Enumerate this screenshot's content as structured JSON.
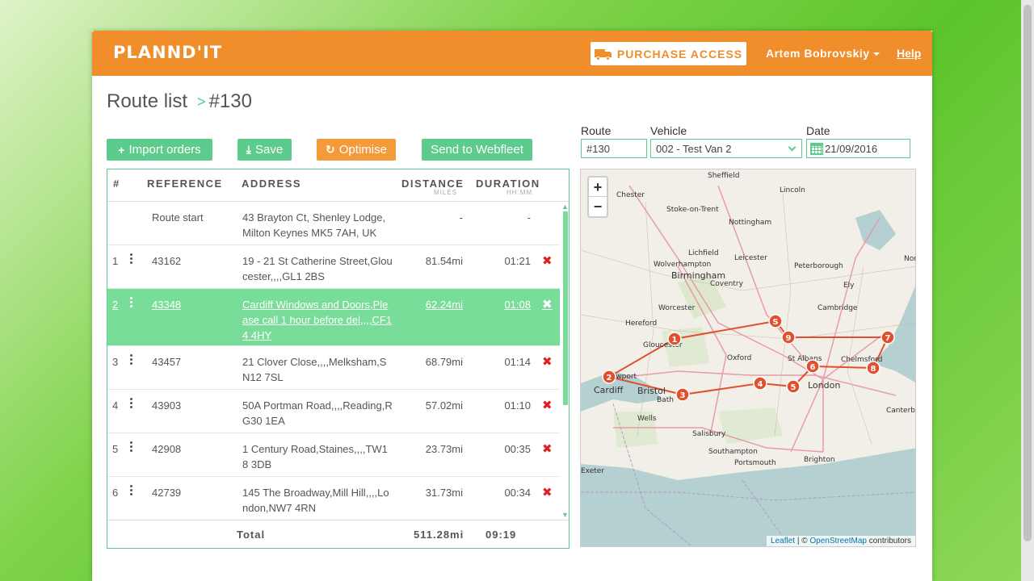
{
  "app": {
    "logo": "PLANND'IT",
    "purchase_label": "PURCHASE ACCESS",
    "user_name": "Artem Bobrovskiy",
    "help_label": "Help"
  },
  "breadcrumb": {
    "root": "Route list",
    "current": "#130"
  },
  "toolbar": {
    "import": "Import orders",
    "save": "Save",
    "optimise": "Optimise",
    "send": "Send to Webfleet"
  },
  "fields": {
    "route_label": "Route",
    "route_value": "#130",
    "vehicle_label": "Vehicle",
    "vehicle_value": "002 - Test Van 2",
    "date_label": "Date",
    "date_value": "21/09/2016"
  },
  "table": {
    "headers": {
      "num": "#",
      "ref": "REFERENCE",
      "addr": "ADDRESS",
      "dist": "DISTANCE",
      "dist_unit": "MILES",
      "dur": "DURATION",
      "dur_unit": "HH:MM"
    },
    "rows": [
      {
        "num": "",
        "ref": "Route start",
        "addr": "43 Brayton Ct, Shenley Lodge, Milton Keynes MK5 7AH, UK",
        "dist": "-",
        "dur": "-"
      },
      {
        "num": "1",
        "ref": "43162",
        "addr": "19 - 21 St Catherine Street,Gloucester,,,,GL1 2BS",
        "dist": "81.54mi",
        "dur": "01:21"
      },
      {
        "num": "2",
        "ref": "43348",
        "addr": "Cardiff Windows and Doors,Please call 1 hour before del,,,,CF14 4HY",
        "dist": "62.24mi",
        "dur": "01:08"
      },
      {
        "num": "3",
        "ref": "43457",
        "addr": "21 Clover Close,,,,Melksham,SN12 7SL",
        "dist": "68.79mi",
        "dur": "01:14"
      },
      {
        "num": "4",
        "ref": "43903",
        "addr": "50A Portman Road,,,,Reading,RG30 1EA",
        "dist": "57.02mi",
        "dur": "01:10"
      },
      {
        "num": "5",
        "ref": "42908",
        "addr": "1 Century Road,Staines,,,,TW18 3DB",
        "dist": "23.73mi",
        "dur": "00:35"
      },
      {
        "num": "6",
        "ref": "42739",
        "addr": "145 The Broadway,Mill Hill,,,,London,NW7 4RN",
        "dist": "31.73mi",
        "dur": "00:34"
      }
    ],
    "footer": {
      "label": "Total",
      "dist": "511.28mi",
      "dur": "09:19"
    }
  },
  "map": {
    "zoom_in": "+",
    "zoom_out": "−",
    "attr_leaflet": "Leaflet",
    "attr_sep": " | © ",
    "attr_osm": "OpenStreetMap",
    "attr_rest": " contributors",
    "places": [
      "Sheffield",
      "Chester",
      "Lincoln",
      "Stoke-on-Trent",
      "Nottingham",
      "Lichfield",
      "Leicester",
      "Wolverhampton",
      "Peterborough",
      "Birmingham",
      "Nor",
      "Coventry",
      "Ely",
      "Worcester",
      "Cambridge",
      "Hereford",
      "Gloucester",
      "Oxford",
      "St Albans",
      "Chelmsford",
      "Newport",
      "Cardiff",
      "Bristol",
      "Bath",
      "London",
      "Wells",
      "Canterbury",
      "Salisbury",
      "Southampton",
      "Brighton",
      "Portsmouth",
      "Exeter"
    ],
    "markers": [
      "1",
      "2",
      "3",
      "4",
      "5",
      "6",
      "7",
      "8",
      "9",
      "S"
    ]
  },
  "colors": {
    "orange": "#ef8e2a",
    "green": "#5ccb8b",
    "selected_row": "#77dd99",
    "route_line": "#e0502e"
  }
}
